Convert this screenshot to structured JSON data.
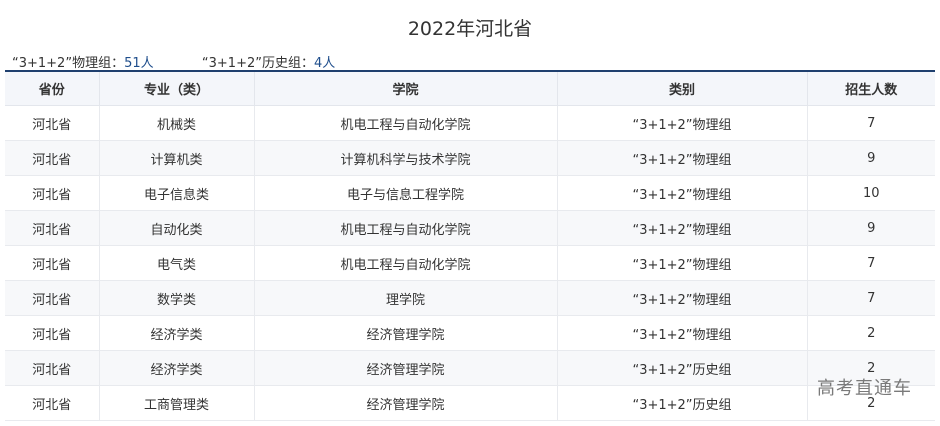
{
  "title": "2022年河北省",
  "summary": {
    "physics_label": "“3+1+2”物理组：",
    "physics_count": "51人",
    "history_label": "“3+1+2”历史组：",
    "history_count": "4人"
  },
  "table": {
    "headers": [
      "省份",
      "专业（类）",
      "学院",
      "类别",
      "招生人数"
    ],
    "rows": [
      [
        "河北省",
        "机械类",
        "机电工程与自动化学院",
        "“3+1+2”物理组",
        "7"
      ],
      [
        "河北省",
        "计算机类",
        "计算机科学与技术学院",
        "“3+1+2”物理组",
        "9"
      ],
      [
        "河北省",
        "电子信息类",
        "电子与信息工程学院",
        "“3+1+2”物理组",
        "10"
      ],
      [
        "河北省",
        "自动化类",
        "机电工程与自动化学院",
        "“3+1+2”物理组",
        "9"
      ],
      [
        "河北省",
        "电气类",
        "机电工程与自动化学院",
        "“3+1+2”物理组",
        "7"
      ],
      [
        "河北省",
        "数学类",
        "理学院",
        "“3+1+2”物理组",
        "7"
      ],
      [
        "河北省",
        "经济学类",
        "经济管理学院",
        "“3+1+2”物理组",
        "2"
      ],
      [
        "河北省",
        "经济学类",
        "经济管理学院",
        "“3+1+2”历史组",
        "2"
      ],
      [
        "河北省",
        "工商管理类",
        "经济管理学院",
        "“3+1+2”历史组",
        "2"
      ]
    ]
  },
  "watermark": "高考直通车"
}
